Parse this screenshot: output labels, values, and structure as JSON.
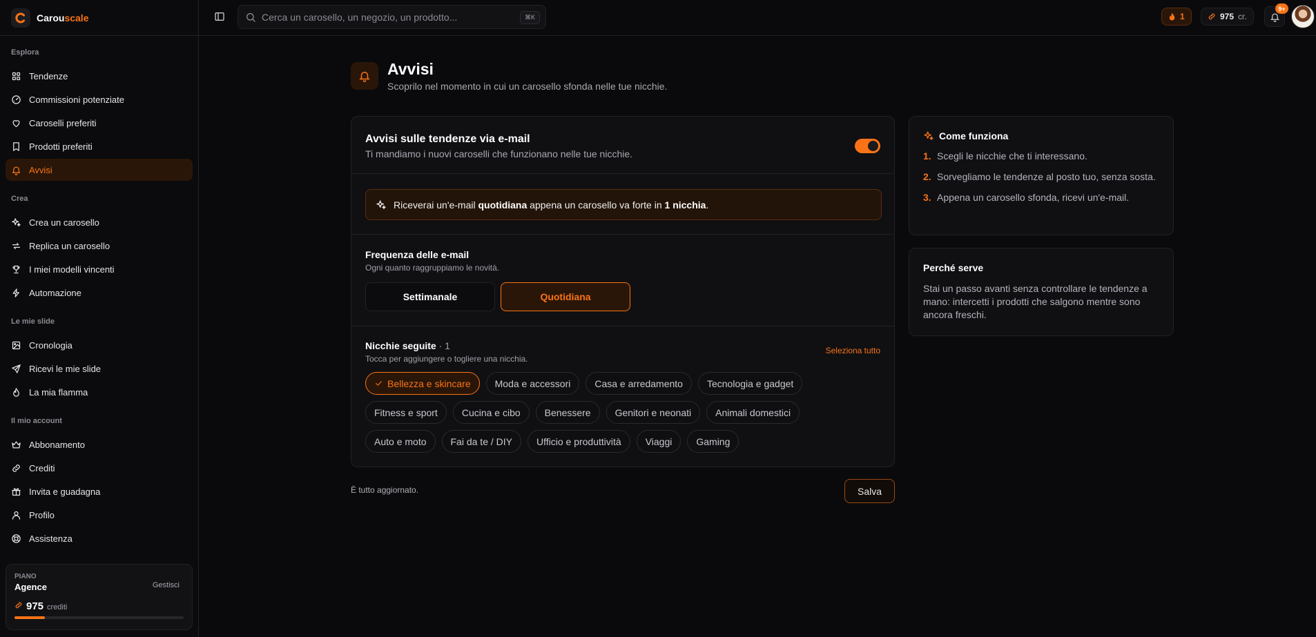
{
  "brand": {
    "name_part1": "Carou",
    "name_part2": "scale"
  },
  "sidebar": {
    "sections": [
      {
        "title": "Esplora",
        "items": [
          {
            "label": "Tendenze",
            "icon": "grid-icon"
          },
          {
            "label": "Commissioni potenziate",
            "icon": "gauge-icon"
          },
          {
            "label": "Caroselli preferiti",
            "icon": "heart-icon"
          },
          {
            "label": "Prodotti preferiti",
            "icon": "bookmark-icon"
          },
          {
            "label": "Avvisi",
            "icon": "bell-icon",
            "active": true
          }
        ]
      },
      {
        "title": "Crea",
        "items": [
          {
            "label": "Crea un carosello",
            "icon": "sparkles-icon"
          },
          {
            "label": "Replica un carosello",
            "icon": "repeat-icon"
          },
          {
            "label": "I miei modelli vincenti",
            "icon": "trophy-icon"
          },
          {
            "label": "Automazione",
            "icon": "bolt-icon"
          }
        ]
      },
      {
        "title": "Le mie slide",
        "items": [
          {
            "label": "Cronologia",
            "icon": "image-icon"
          },
          {
            "label": "Ricevi le mie slide",
            "icon": "send-icon"
          },
          {
            "label": "La mia flamma",
            "icon": "flame-icon"
          }
        ]
      },
      {
        "title": "Il mio account",
        "items": [
          {
            "label": "Abbonamento",
            "icon": "crown-icon"
          },
          {
            "label": "Crediti",
            "icon": "link-icon"
          },
          {
            "label": "Invita e guadagna",
            "icon": "gift-icon"
          },
          {
            "label": "Profilo",
            "icon": "user-icon"
          },
          {
            "label": "Assistenza",
            "icon": "lifebuoy-icon"
          }
        ]
      }
    ],
    "plan": {
      "label": "PIANO",
      "name": "Agence",
      "manage": "Gestisci",
      "credits": "975",
      "credits_unit": "crediti",
      "credits_fraction": 0.18
    }
  },
  "topbar": {
    "search_placeholder": "Cerca un carosello, un negozio, un prodotto...",
    "shortcut": "⌘K",
    "streak": "1",
    "credits": "975",
    "credits_unit": "cr.",
    "notif_badge": "9+"
  },
  "page": {
    "title": "Avvisi",
    "subtitle": "Scoprilo nel momento in cui un carosello sfonda nelle tue nicchie."
  },
  "email_alerts": {
    "title": "Avvisi sulle tendenze via e-mail",
    "subtitle": "Ti mandiamo i nuovi caroselli che funzionano nelle tue nicchie.",
    "enabled": true,
    "banner_prefix": "Riceverai un'e-mail ",
    "banner_bold1": "quotidiana",
    "banner_mid": " appena un carosello va forte in ",
    "banner_bold2": "1 nicchia",
    "banner_suffix": "."
  },
  "frequency": {
    "title": "Frequenza delle e-mail",
    "subtitle": "Ogni quanto raggruppiamo le novità.",
    "options": [
      "Settimanale",
      "Quotidiana"
    ],
    "selected": "Quotidiana"
  },
  "niches": {
    "title": "Nicchie seguite",
    "count": " · 1",
    "subtitle": "Tocca per aggiungere o togliere una nicchia.",
    "select_all": "Seleziona tutto",
    "rows": [
      [
        {
          "label": "Bellezza e skincare",
          "selected": true
        },
        {
          "label": "Moda e accessori"
        },
        {
          "label": "Casa e arredamento"
        },
        {
          "label": "Tecnologia e gadget"
        }
      ],
      [
        {
          "label": "Fitness e sport"
        },
        {
          "label": "Cucina e cibo"
        },
        {
          "label": "Benessere"
        },
        {
          "label": "Genitori e neonati"
        },
        {
          "label": "Animali domestici"
        }
      ],
      [
        {
          "label": "Auto e moto"
        },
        {
          "label": "Fai da te / DIY"
        },
        {
          "label": "Ufficio e produttività"
        },
        {
          "label": "Viaggi"
        },
        {
          "label": "Gaming"
        }
      ]
    ]
  },
  "footer": {
    "status": "È tutto aggiornato.",
    "save": "Salva"
  },
  "how_it_works": {
    "title": "Come funziona",
    "steps": [
      {
        "n": "1.",
        "text": "Scegli le nicchie che ti interessano."
      },
      {
        "n": "2.",
        "text": "Sorvegliamo le tendenze al posto tuo, senza sosta."
      },
      {
        "n": "3.",
        "text": "Appena un carosello sfonda, ricevi un'e-mail."
      }
    ]
  },
  "why": {
    "title": "Perché serve",
    "text": "Stai un passo avanti senza controllare le tendenze a mano: intercetti i prodotti che salgono mentre sono ancora freschi."
  },
  "colors": {
    "accent": "#f97316",
    "background": "#0a0a0c"
  }
}
